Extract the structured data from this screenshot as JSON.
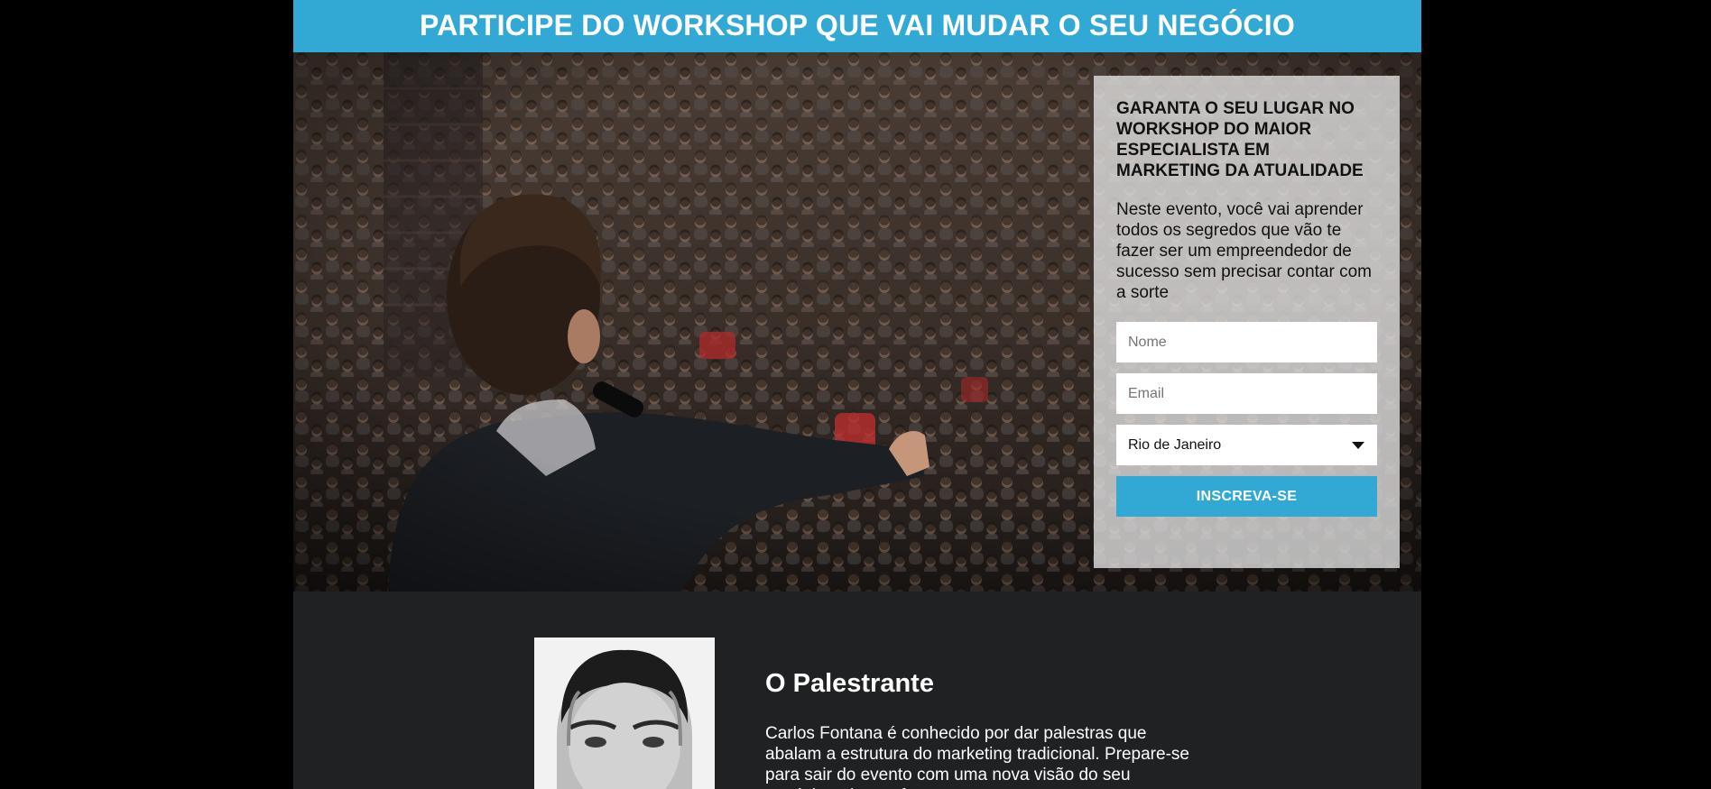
{
  "banner": {
    "title": "PARTICIPE DO WORKSHOP QUE VAI MUDAR O SEU NEGÓCIO"
  },
  "hero": {
    "image": "speaker-with-microphone-facing-audience"
  },
  "signup": {
    "heading": "GARANTA O SEU LUGAR NO WORKSHOP DO MAIOR ESPECIALISTA EM MARKETING DA ATUALIDADE",
    "description": "Neste evento, você vai aprender todos os segredos que vão te fazer ser um empreendedor de sucesso sem precisar contar com a sorte",
    "name_placeholder": "Nome",
    "email_placeholder": "Email",
    "city_selected": "Rio de Janeiro",
    "submit_label": "INSCREVA-SE"
  },
  "speaker": {
    "title": "O Palestrante",
    "bio": "Carlos Fontana é conhecido por dar palestras que abalam a estrutura do marketing tradicional. Prepare-se para sair do evento com uma nova visão do seu negócio e do seu futuro.",
    "photo": "speaker-portrait"
  },
  "colors": {
    "accent": "#32a9d4",
    "section_bg": "#202122",
    "page_bg": "#000000",
    "panel_bg": "#e4e4e4"
  }
}
